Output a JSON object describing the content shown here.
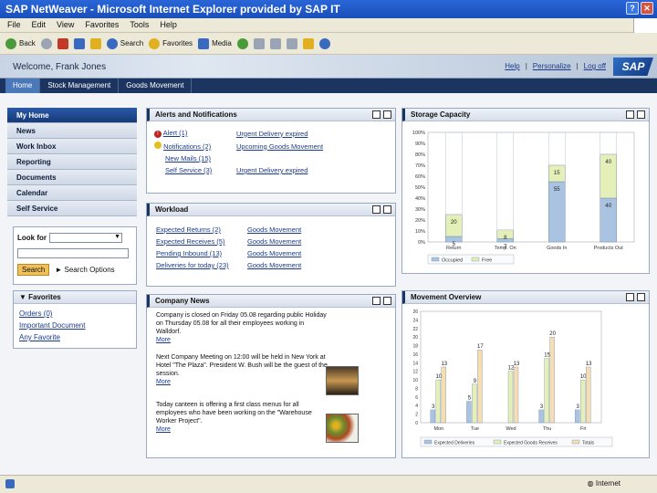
{
  "window": {
    "title": "SAP NetWeaver - Microsoft Internet Explorer provided by SAP IT",
    "menus": [
      "File",
      "Edit",
      "View",
      "Favorites",
      "Tools",
      "Help"
    ]
  },
  "toolbar": {
    "back": "Back",
    "search": "Search",
    "favorites": "Favorites",
    "media": "Media"
  },
  "header": {
    "welcome": "Welcome, Frank Jones",
    "help": "Help",
    "personalize": "Personalize",
    "logoff": "Log off",
    "logo": "SAP"
  },
  "topnav": {
    "tabs": [
      "Home",
      "Stock Management",
      "Goods Movement"
    ]
  },
  "leftnav": {
    "items": [
      "My Home",
      "News",
      "Work Inbox",
      "Reporting",
      "Documents",
      "Calendar",
      "Self Service"
    ]
  },
  "search": {
    "look_for": "Look for",
    "search_btn": "Search",
    "options": "Search Options"
  },
  "favorites": {
    "title": "Favorites",
    "items": [
      "Orders (0)",
      "Important Document",
      "Any Favorite"
    ]
  },
  "alerts": {
    "title": "Alerts and Notifications",
    "rows": [
      {
        "left": "Alert (1)",
        "right": "Urgent Delivery expired",
        "icon": "error-icon"
      },
      {
        "left": "Notifications (2)",
        "right": "Upcoming Goods Movement",
        "icon": "bell-icon"
      },
      {
        "left": "New Mails (15)",
        "right": "",
        "icon": ""
      },
      {
        "left": "Self Service (3)",
        "right": "Urgent Delivery expired",
        "icon": ""
      }
    ]
  },
  "workload": {
    "title": "Workload",
    "rows": [
      {
        "left": "Expected Returns (2)",
        "right": "Goods Movement"
      },
      {
        "left": "Expected Receives (5)",
        "right": "Goods Movement"
      },
      {
        "left": "Pending Inbound (13)",
        "right": "Goods Movement"
      },
      {
        "left": "Deliveries for today (23)",
        "right": "Goods Movement"
      }
    ]
  },
  "news": {
    "title": "Company News",
    "items": [
      {
        "text": "Company is closed on Friday 05.08 regarding public Holiday on Thursday 05.08 for all their employees working in Walldorf.",
        "more": "More"
      },
      {
        "text": "Next Company Meeting on 12:00 will be held in New York at Hotel \"The Plaza\". President W. Bush will be the guest of the session.",
        "more": "More"
      },
      {
        "text": "Today canteen is offering a first class menus for all employees who have been working on the \"Warehouse Worker Project\".",
        "more": "More"
      }
    ]
  },
  "chart_data": [
    {
      "type": "bar",
      "title": "Storage Capacity",
      "categories": [
        "Return",
        "Temp. On",
        "Goods In",
        "Products Out"
      ],
      "ylim": [
        0,
        100
      ],
      "yticks": [
        "100%",
        "90%",
        "80%",
        "70%",
        "60%",
        "50%",
        "40%",
        "30%",
        "20%",
        "10%",
        "0%"
      ],
      "stacked": true,
      "series": [
        {
          "name": "Occupied",
          "values": [
            5,
            3,
            55,
            40
          ],
          "color": "#a9c3e0"
        },
        {
          "name": "Free",
          "values": [
            20,
            8,
            15,
            40
          ],
          "color": "#e4f0b8"
        }
      ],
      "legend": "bottom"
    },
    {
      "type": "bar",
      "title": "Movement Overview",
      "categories": [
        "Mon",
        "Tue",
        "Wed",
        "Thu",
        "Fri"
      ],
      "ylim": [
        0,
        26
      ],
      "yticks": [
        "26",
        "24",
        "22",
        "20",
        "18",
        "16",
        "14",
        "12",
        "10",
        "8",
        "6",
        "4",
        "2",
        "0"
      ],
      "series": [
        {
          "name": "Expected Deliveries",
          "values": [
            3,
            5,
            0,
            3,
            3
          ],
          "color": "#a9c3e0"
        },
        {
          "name": "Expected Goods Receives",
          "values": [
            10,
            9,
            12,
            15,
            10
          ],
          "color": "#e4f0b8"
        },
        {
          "name": "Totals",
          "values": [
            13,
            17,
            13,
            20,
            13
          ],
          "color": "#f6ddb2"
        }
      ],
      "labels": [
        [
          "3",
          "10",
          "13"
        ],
        [
          "5",
          "9",
          "17"
        ],
        [
          "",
          "12",
          "13"
        ],
        [
          "3",
          "15",
          "20"
        ],
        [
          "3",
          "10",
          "13"
        ]
      ],
      "legend": "bottom"
    }
  ],
  "status": {
    "zone": "Internet"
  }
}
